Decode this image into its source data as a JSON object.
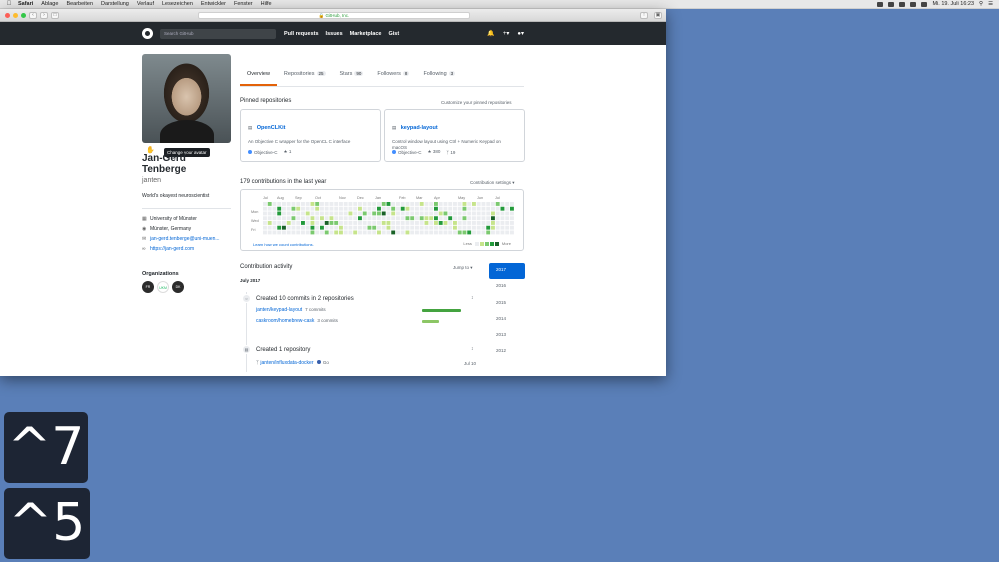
{
  "menubar": {
    "apple": "",
    "items": [
      "Safari",
      "Ablage",
      "Bearbeiten",
      "Darstellung",
      "Verlauf",
      "Lesezeichen",
      "Entwickler",
      "Fenster",
      "Hilfe"
    ],
    "clock": "Mi. 19. Juli 16:23"
  },
  "browser": {
    "url": "GitHub, Inc."
  },
  "github": {
    "search_placeholder": "Search GitHub",
    "nav": [
      "Pull requests",
      "Issues",
      "Marketplace",
      "Gist"
    ]
  },
  "profile": {
    "tooltip": "Change your avatar",
    "name": "Jan-Gerd Tenberge",
    "login": "janten",
    "bio": "World's okayest neuroscientist",
    "organization": "University of Münster",
    "location": "Münster, Germany",
    "email": "jan-gerd.tenberge@uni-muen...",
    "website": "https://jan-gerd.com",
    "orgs_title": "Organizations",
    "orgs": [
      "FR",
      "UKM",
      "DK"
    ]
  },
  "tabs": [
    {
      "label": "Overview",
      "count": ""
    },
    {
      "label": "Repositories",
      "count": "25"
    },
    {
      "label": "Stars",
      "count": "90"
    },
    {
      "label": "Followers",
      "count": "8"
    },
    {
      "label": "Following",
      "count": "3"
    }
  ],
  "pinned": {
    "title": "Pinned repositories",
    "customize": "Customize your pinned repositories",
    "repos": [
      {
        "name": "OpenCLKit",
        "desc": "An Objective C wrapper for the OpenCL C interface",
        "lang": "Objective-C",
        "stars": "1",
        "forks": ""
      },
      {
        "name": "keypad-layout",
        "desc": "Control window layout using Ctrl + Numeric Keypad on macOS",
        "lang": "Objective-C",
        "stars": "380",
        "forks": "19"
      }
    ]
  },
  "contributions": {
    "title": "179 contributions in the last year",
    "settings": "Contribution settings ▾",
    "months": [
      "Jul",
      "Aug",
      "Sep",
      "Oct",
      "Nov",
      "Dec",
      "Jan",
      "Feb",
      "Mar",
      "Apr",
      "May",
      "Jun",
      "Jul"
    ],
    "days": [
      "Mon",
      "Wed",
      "Fri"
    ],
    "footer": "Learn how we count contributions.",
    "less": "Less",
    "more": "More",
    "colors": [
      "#ebedf0",
      "#c6e48b",
      "#7bc96f",
      "#239a3b",
      "#196127"
    ]
  },
  "activity": {
    "title": "Contribution activity",
    "jump": "Jump to ▾",
    "month": "July 2017",
    "years": [
      "2017",
      "2016",
      "2015",
      "2014",
      "2013",
      "2012"
    ],
    "commits_head": "Created 10 commits in 2 repositories",
    "commit_rows": [
      {
        "repo": "janten/keypad-layout",
        "count": "7 commits",
        "fill": 0.7
      },
      {
        "repo": "caskroom/homebrew-cask",
        "count": "3 commits",
        "fill": 0.3
      }
    ],
    "repo_head": "Created 1 repository",
    "new_repo": "janten/influxdata-docker",
    "new_repo_lang": "Go",
    "new_repo_date": "Jul 10"
  },
  "keys": [
    "^7",
    "^5"
  ]
}
